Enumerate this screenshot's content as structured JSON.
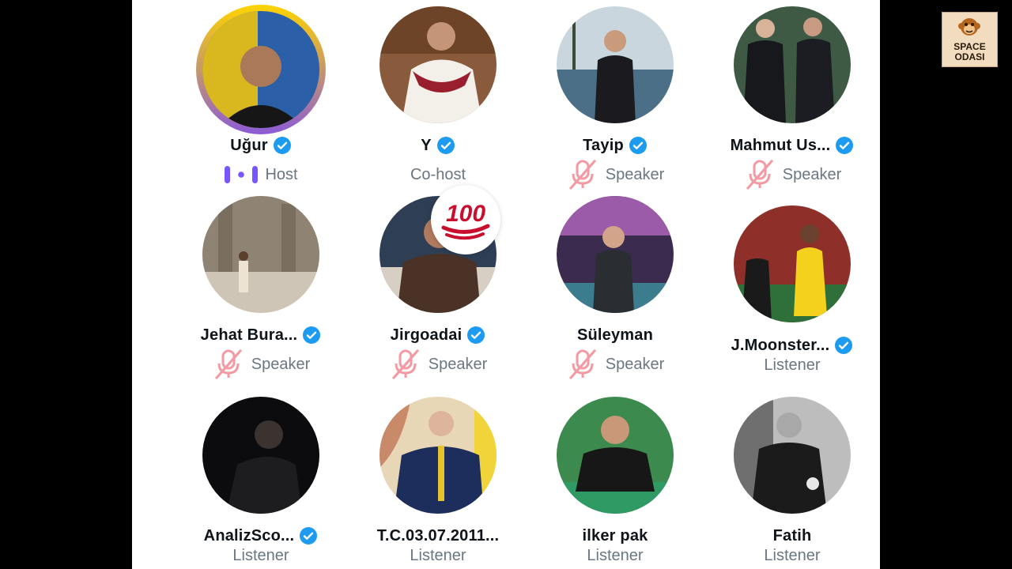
{
  "logo": {
    "line1": "SPACE",
    "line2": "ODASI"
  },
  "badge": {
    "emoji": "100",
    "icon": "hundred-points-icon"
  },
  "colors": {
    "verified": "#1d9bf0",
    "mic_off": "#f4212e",
    "host_bars": "#7856ff",
    "host_ring_top": "#ffd400",
    "host_ring_bottom": "#7856ff"
  },
  "participants": [
    {
      "name": "Uğur",
      "role": "Host",
      "verified": true
    },
    {
      "name": "Y",
      "role": "Co-host",
      "verified": true
    },
    {
      "name": "Tayip",
      "role": "Speaker",
      "verified": true,
      "muted": true
    },
    {
      "name": "Mahmut Us...",
      "role": "Speaker",
      "verified": true,
      "muted": true
    },
    {
      "name": "Jehat Bura...",
      "role": "Speaker",
      "verified": true,
      "muted": true
    },
    {
      "name": "Jirgoadai",
      "role": "Speaker",
      "verified": true,
      "muted": true
    },
    {
      "name": "Süleyman",
      "role": "Speaker",
      "verified": false,
      "muted": true
    },
    {
      "name": "J.Moonster...",
      "role": "Listener",
      "verified": true
    },
    {
      "name": "AnalizSco...",
      "role": "Listener",
      "verified": true
    },
    {
      "name": "T.C.03.07.2011...",
      "role": "Listener",
      "verified": false
    },
    {
      "name": "ilker pak",
      "role": "Listener",
      "verified": false
    },
    {
      "name": "Fatih",
      "role": "Listener",
      "verified": false
    }
  ]
}
